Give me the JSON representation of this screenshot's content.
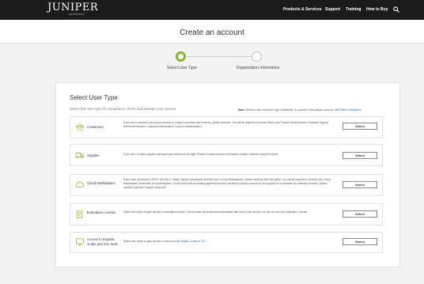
{
  "header": {
    "logo": "JUNIPER",
    "logo_sub": "NETWORKS",
    "nav": [
      "Products & Services",
      "Support",
      "Training",
      "How to Buy"
    ],
    "search_icon": "search-icon"
  },
  "page_title": "Create an account",
  "stepper": {
    "steps": [
      {
        "label": "Select User Type",
        "active": true
      },
      {
        "label": "Organization Information",
        "active": false
      }
    ],
    "accent": "#86b52c"
  },
  "card": {
    "title": "Select User Type",
    "subtitle": "Select the user type for compliance check and activate your access",
    "note_bold": "Note:",
    "note_text": " Partners have exclusive login credentials. To request a new partner account, visit ",
    "note_link": "Partner Assistance"
  },
  "rows": [
    {
      "name": "Customers",
      "icon": "users-icon",
      "desc": "If you are a customer and require access to Juniper's products and services, please continue. You will be required to provide either your Product Serial Number, Software Support Reference Number, Customer Authorization Code for authentication.",
      "button": "Select"
    },
    {
      "name": "Supplier",
      "icon": "truck-icon",
      "desc": "If you are a Juniper supplier wishing to gain access to the Agile Portal to browse product information, please continue using this option.",
      "button": "Select"
    },
    {
      "name": "Cloud Marketplace",
      "icon": "cloud-icon",
      "desc": "If you have purchased a PAYG (Hourly or Yearly) Juniper subscription directly from a Cloud Marketplace, please continue with this option. You will be required to provide your Cloud Marketplace credentials for authentication. Cloud users with an existing approved account wishing to discuss options for an upgrade or to evaluate our software products, please contact Customer Support via phone.",
      "button": "Select"
    },
    {
      "name": "Evaluation License",
      "icon": "license-icon",
      "desc": "Select this option to gain access to evaluation license. This includes all permissions associated with Guest User access, as well as a 60 day Evaluation License.",
      "button": "Select"
    },
    {
      "name": "Access to EngNet, vLabs and JCL tools",
      "icon": "monitor-icon",
      "desc_prefix": "Select this option to gain access to tools such as ",
      "desc_link": "EngNet, vLabs or JCL",
      "desc_suffix": ".",
      "button": "Select"
    }
  ]
}
